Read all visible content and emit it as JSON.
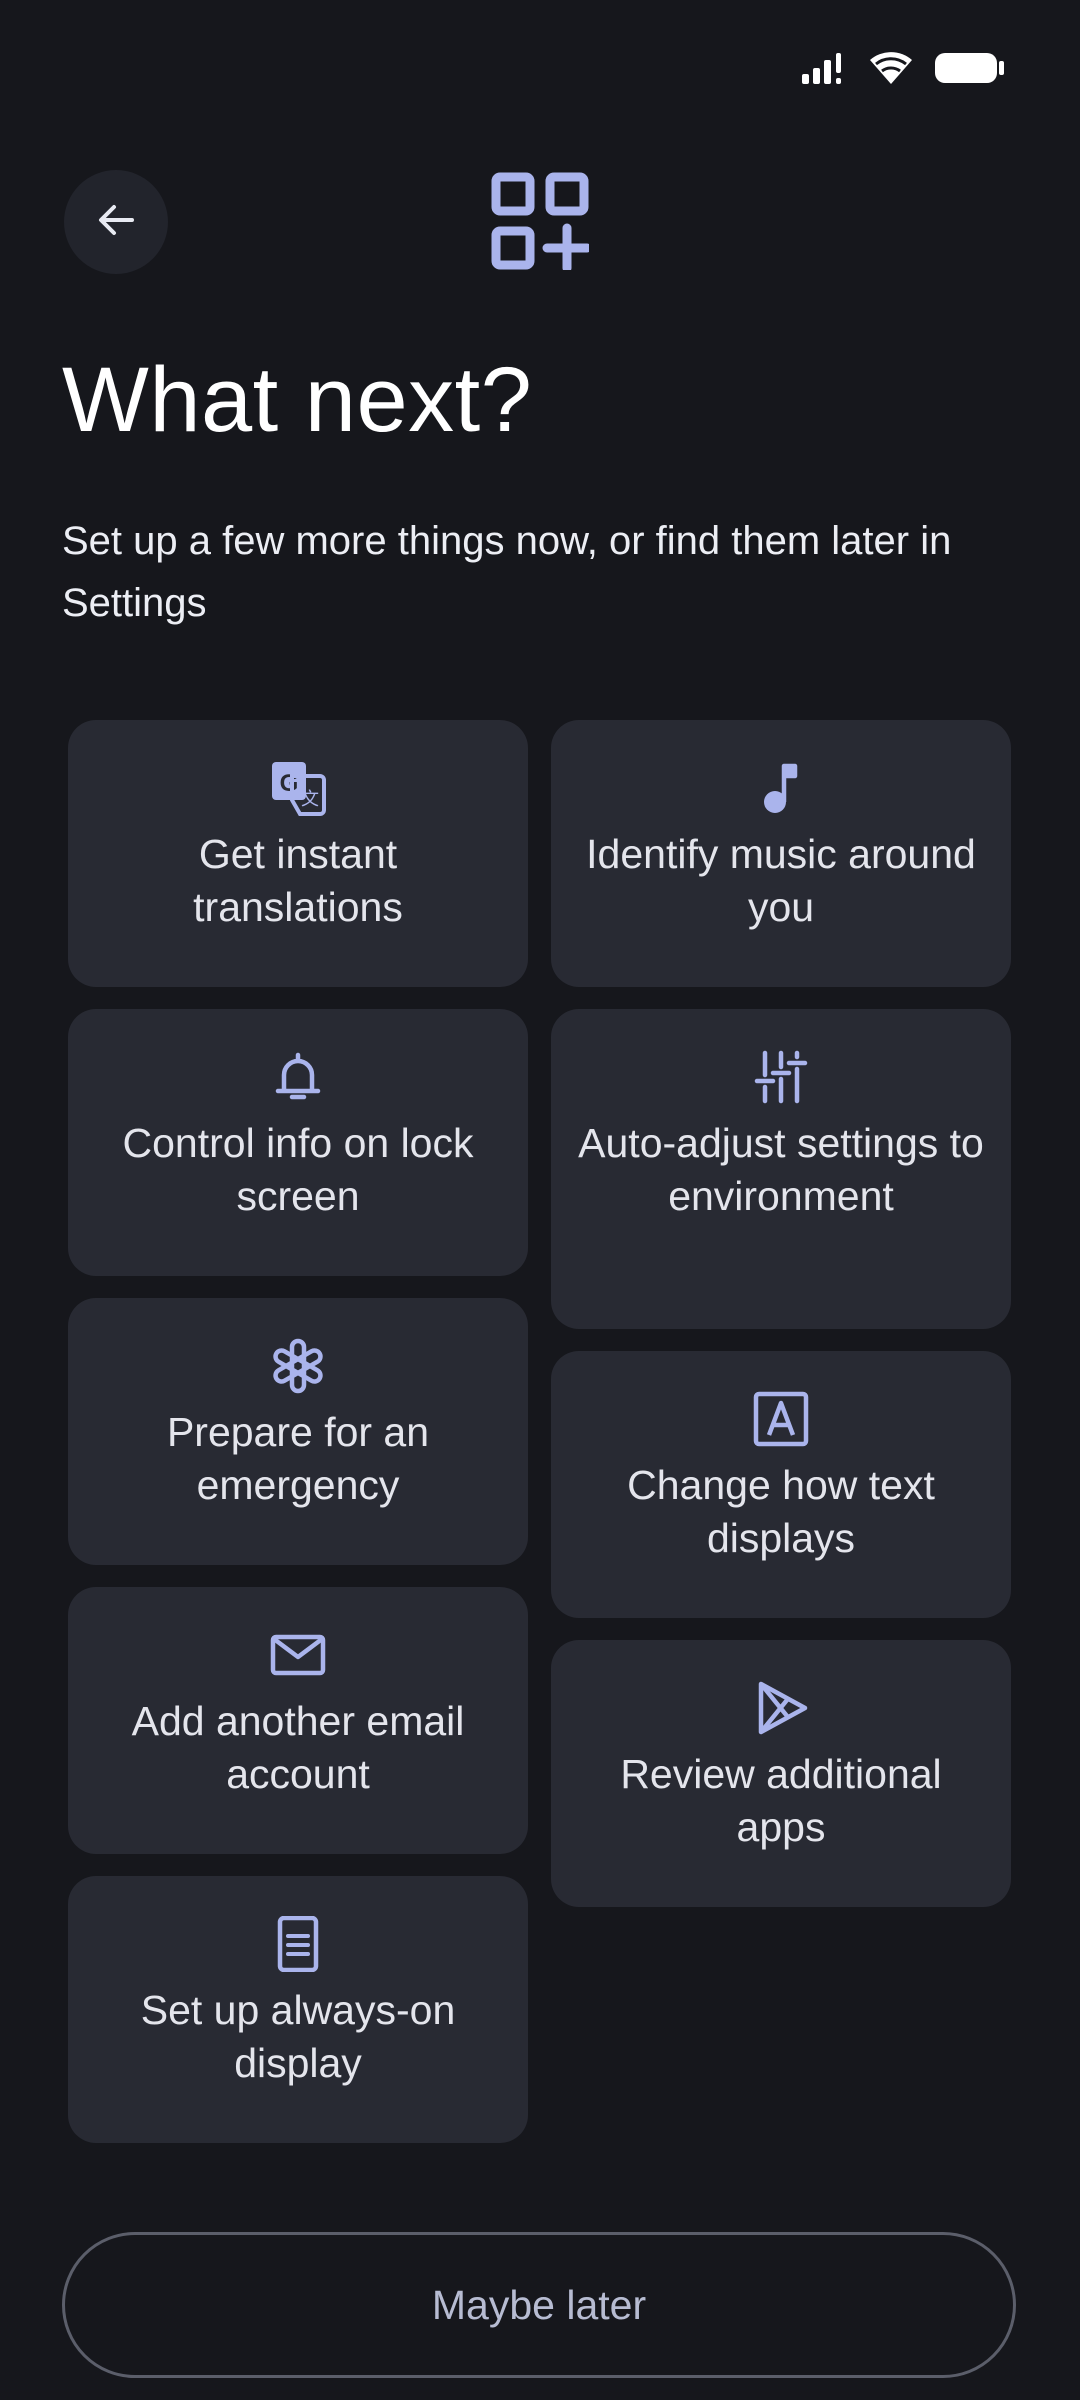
{
  "header": {
    "title": "What next?",
    "subtitle": "Set up a few more things now, or find them later in Settings"
  },
  "colors": {
    "background": "#16171c",
    "card": "#282a33",
    "accent": "#aab4ec",
    "text": "#e4e5ec"
  },
  "cards": [
    {
      "label": "Get instant translations",
      "icon": "translate-icon"
    },
    {
      "label": "Identify music around you",
      "icon": "music-note-icon"
    },
    {
      "label": "Control info on lock screen",
      "icon": "bell-icon"
    },
    {
      "label": "Auto-adjust settings to environment",
      "icon": "tune-sliders-icon"
    },
    {
      "label": "Prepare for an emergency",
      "icon": "emergency-asterisk-icon"
    },
    {
      "label": "Change how text displays",
      "icon": "text-format-icon"
    },
    {
      "label": "Add another email account",
      "icon": "mail-icon"
    },
    {
      "label": "Review additional apps",
      "icon": "play-store-icon"
    },
    {
      "label": "Set up always-on display",
      "icon": "phone-display-icon"
    }
  ],
  "footer": {
    "maybe_later_label": "Maybe later"
  }
}
